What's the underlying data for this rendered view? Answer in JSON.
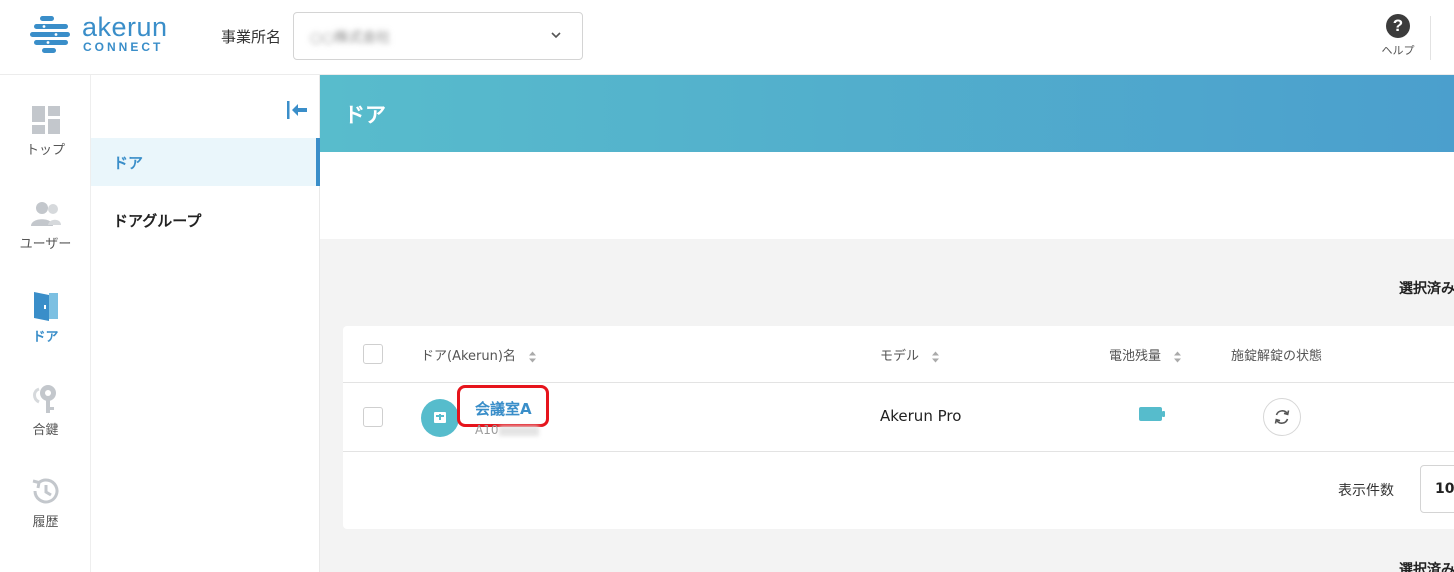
{
  "header": {
    "logo_text": "akerun",
    "logo_sub": "CONNECT",
    "office_label": "事業所名",
    "office_value": "○○株式会社",
    "help_label": "ヘルプ"
  },
  "nav": {
    "items": [
      {
        "label": "トップ",
        "icon": "dashboard-icon"
      },
      {
        "label": "ユーザー",
        "icon": "users-icon"
      },
      {
        "label": "ドア",
        "icon": "door-icon",
        "active": true
      },
      {
        "label": "合鍵",
        "icon": "key-icon"
      },
      {
        "label": "履歴",
        "icon": "history-icon"
      }
    ]
  },
  "submenu": {
    "items": [
      {
        "label": "ドア",
        "active": true
      },
      {
        "label": "ドアグループ"
      }
    ]
  },
  "page": {
    "title": "ドア",
    "selected_label": "選択済み",
    "selected_label_bottom": "選択済み"
  },
  "table": {
    "columns": [
      {
        "label": "ドア(Akerun)名",
        "sortable": true
      },
      {
        "label": "モデル",
        "sortable": true
      },
      {
        "label": "電池残量",
        "sortable": true
      },
      {
        "label": "施錠解錠の状態",
        "sortable": false
      }
    ],
    "rows": [
      {
        "name": "会議室A",
        "id_prefix": "A10",
        "model": "Akerun Pro",
        "battery": "full"
      }
    ],
    "per_page_label": "表示件数",
    "per_page_value": "10"
  },
  "colors": {
    "accent": "#3a8ec9",
    "banner_start": "#58bccc",
    "banner_end": "#4b9fcd",
    "highlight": "#e6141c",
    "battery": "#56bccc"
  }
}
